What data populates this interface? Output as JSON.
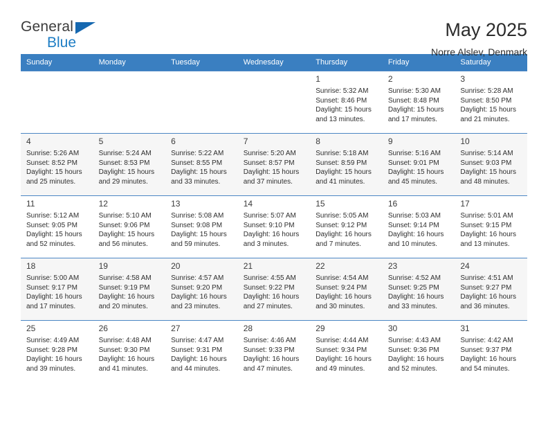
{
  "brand": {
    "line1": "General",
    "line2": "Blue",
    "triangle_icon": "triangle-icon",
    "colors": {
      "general_text": "#3b3b3b",
      "blue_text": "#1d7dc4",
      "triangle": "#1668b0"
    }
  },
  "header": {
    "title": "May 2025",
    "subtitle": "Norre Alslev, Denmark"
  },
  "theme": {
    "header_row_bg": "#3a7fc1",
    "header_row_text": "#ffffff",
    "row_divider": "#4a86c4",
    "alt_row_bg": "#f6f6f6"
  },
  "calendar": {
    "weekday_headers": [
      "Sunday",
      "Monday",
      "Tuesday",
      "Wednesday",
      "Thursday",
      "Friday",
      "Saturday"
    ],
    "weeks": [
      [
        {
          "day": "",
          "sunrise": "",
          "sunset": "",
          "daylight_line1": "",
          "daylight_line2": "",
          "empty": true
        },
        {
          "day": "",
          "sunrise": "",
          "sunset": "",
          "daylight_line1": "",
          "daylight_line2": "",
          "empty": true
        },
        {
          "day": "",
          "sunrise": "",
          "sunset": "",
          "daylight_line1": "",
          "daylight_line2": "",
          "empty": true
        },
        {
          "day": "",
          "sunrise": "",
          "sunset": "",
          "daylight_line1": "",
          "daylight_line2": "",
          "empty": true
        },
        {
          "day": "1",
          "sunrise": "Sunrise: 5:32 AM",
          "sunset": "Sunset: 8:46 PM",
          "daylight_line1": "Daylight: 15 hours",
          "daylight_line2": "and 13 minutes."
        },
        {
          "day": "2",
          "sunrise": "Sunrise: 5:30 AM",
          "sunset": "Sunset: 8:48 PM",
          "daylight_line1": "Daylight: 15 hours",
          "daylight_line2": "and 17 minutes."
        },
        {
          "day": "3",
          "sunrise": "Sunrise: 5:28 AM",
          "sunset": "Sunset: 8:50 PM",
          "daylight_line1": "Daylight: 15 hours",
          "daylight_line2": "and 21 minutes."
        }
      ],
      [
        {
          "day": "4",
          "sunrise": "Sunrise: 5:26 AM",
          "sunset": "Sunset: 8:52 PM",
          "daylight_line1": "Daylight: 15 hours",
          "daylight_line2": "and 25 minutes."
        },
        {
          "day": "5",
          "sunrise": "Sunrise: 5:24 AM",
          "sunset": "Sunset: 8:53 PM",
          "daylight_line1": "Daylight: 15 hours",
          "daylight_line2": "and 29 minutes."
        },
        {
          "day": "6",
          "sunrise": "Sunrise: 5:22 AM",
          "sunset": "Sunset: 8:55 PM",
          "daylight_line1": "Daylight: 15 hours",
          "daylight_line2": "and 33 minutes."
        },
        {
          "day": "7",
          "sunrise": "Sunrise: 5:20 AM",
          "sunset": "Sunset: 8:57 PM",
          "daylight_line1": "Daylight: 15 hours",
          "daylight_line2": "and 37 minutes."
        },
        {
          "day": "8",
          "sunrise": "Sunrise: 5:18 AM",
          "sunset": "Sunset: 8:59 PM",
          "daylight_line1": "Daylight: 15 hours",
          "daylight_line2": "and 41 minutes."
        },
        {
          "day": "9",
          "sunrise": "Sunrise: 5:16 AM",
          "sunset": "Sunset: 9:01 PM",
          "daylight_line1": "Daylight: 15 hours",
          "daylight_line2": "and 45 minutes."
        },
        {
          "day": "10",
          "sunrise": "Sunrise: 5:14 AM",
          "sunset": "Sunset: 9:03 PM",
          "daylight_line1": "Daylight: 15 hours",
          "daylight_line2": "and 48 minutes."
        }
      ],
      [
        {
          "day": "11",
          "sunrise": "Sunrise: 5:12 AM",
          "sunset": "Sunset: 9:05 PM",
          "daylight_line1": "Daylight: 15 hours",
          "daylight_line2": "and 52 minutes."
        },
        {
          "day": "12",
          "sunrise": "Sunrise: 5:10 AM",
          "sunset": "Sunset: 9:06 PM",
          "daylight_line1": "Daylight: 15 hours",
          "daylight_line2": "and 56 minutes."
        },
        {
          "day": "13",
          "sunrise": "Sunrise: 5:08 AM",
          "sunset": "Sunset: 9:08 PM",
          "daylight_line1": "Daylight: 15 hours",
          "daylight_line2": "and 59 minutes."
        },
        {
          "day": "14",
          "sunrise": "Sunrise: 5:07 AM",
          "sunset": "Sunset: 9:10 PM",
          "daylight_line1": "Daylight: 16 hours",
          "daylight_line2": "and 3 minutes."
        },
        {
          "day": "15",
          "sunrise": "Sunrise: 5:05 AM",
          "sunset": "Sunset: 9:12 PM",
          "daylight_line1": "Daylight: 16 hours",
          "daylight_line2": "and 7 minutes."
        },
        {
          "day": "16",
          "sunrise": "Sunrise: 5:03 AM",
          "sunset": "Sunset: 9:14 PM",
          "daylight_line1": "Daylight: 16 hours",
          "daylight_line2": "and 10 minutes."
        },
        {
          "day": "17",
          "sunrise": "Sunrise: 5:01 AM",
          "sunset": "Sunset: 9:15 PM",
          "daylight_line1": "Daylight: 16 hours",
          "daylight_line2": "and 13 minutes."
        }
      ],
      [
        {
          "day": "18",
          "sunrise": "Sunrise: 5:00 AM",
          "sunset": "Sunset: 9:17 PM",
          "daylight_line1": "Daylight: 16 hours",
          "daylight_line2": "and 17 minutes."
        },
        {
          "day": "19",
          "sunrise": "Sunrise: 4:58 AM",
          "sunset": "Sunset: 9:19 PM",
          "daylight_line1": "Daylight: 16 hours",
          "daylight_line2": "and 20 minutes."
        },
        {
          "day": "20",
          "sunrise": "Sunrise: 4:57 AM",
          "sunset": "Sunset: 9:20 PM",
          "daylight_line1": "Daylight: 16 hours",
          "daylight_line2": "and 23 minutes."
        },
        {
          "day": "21",
          "sunrise": "Sunrise: 4:55 AM",
          "sunset": "Sunset: 9:22 PM",
          "daylight_line1": "Daylight: 16 hours",
          "daylight_line2": "and 27 minutes."
        },
        {
          "day": "22",
          "sunrise": "Sunrise: 4:54 AM",
          "sunset": "Sunset: 9:24 PM",
          "daylight_line1": "Daylight: 16 hours",
          "daylight_line2": "and 30 minutes."
        },
        {
          "day": "23",
          "sunrise": "Sunrise: 4:52 AM",
          "sunset": "Sunset: 9:25 PM",
          "daylight_line1": "Daylight: 16 hours",
          "daylight_line2": "and 33 minutes."
        },
        {
          "day": "24",
          "sunrise": "Sunrise: 4:51 AM",
          "sunset": "Sunset: 9:27 PM",
          "daylight_line1": "Daylight: 16 hours",
          "daylight_line2": "and 36 minutes."
        }
      ],
      [
        {
          "day": "25",
          "sunrise": "Sunrise: 4:49 AM",
          "sunset": "Sunset: 9:28 PM",
          "daylight_line1": "Daylight: 16 hours",
          "daylight_line2": "and 39 minutes."
        },
        {
          "day": "26",
          "sunrise": "Sunrise: 4:48 AM",
          "sunset": "Sunset: 9:30 PM",
          "daylight_line1": "Daylight: 16 hours",
          "daylight_line2": "and 41 minutes."
        },
        {
          "day": "27",
          "sunrise": "Sunrise: 4:47 AM",
          "sunset": "Sunset: 9:31 PM",
          "daylight_line1": "Daylight: 16 hours",
          "daylight_line2": "and 44 minutes."
        },
        {
          "day": "28",
          "sunrise": "Sunrise: 4:46 AM",
          "sunset": "Sunset: 9:33 PM",
          "daylight_line1": "Daylight: 16 hours",
          "daylight_line2": "and 47 minutes."
        },
        {
          "day": "29",
          "sunrise": "Sunrise: 4:44 AM",
          "sunset": "Sunset: 9:34 PM",
          "daylight_line1": "Daylight: 16 hours",
          "daylight_line2": "and 49 minutes."
        },
        {
          "day": "30",
          "sunrise": "Sunrise: 4:43 AM",
          "sunset": "Sunset: 9:36 PM",
          "daylight_line1": "Daylight: 16 hours",
          "daylight_line2": "and 52 minutes."
        },
        {
          "day": "31",
          "sunrise": "Sunrise: 4:42 AM",
          "sunset": "Sunset: 9:37 PM",
          "daylight_line1": "Daylight: 16 hours",
          "daylight_line2": "and 54 minutes."
        }
      ]
    ]
  }
}
